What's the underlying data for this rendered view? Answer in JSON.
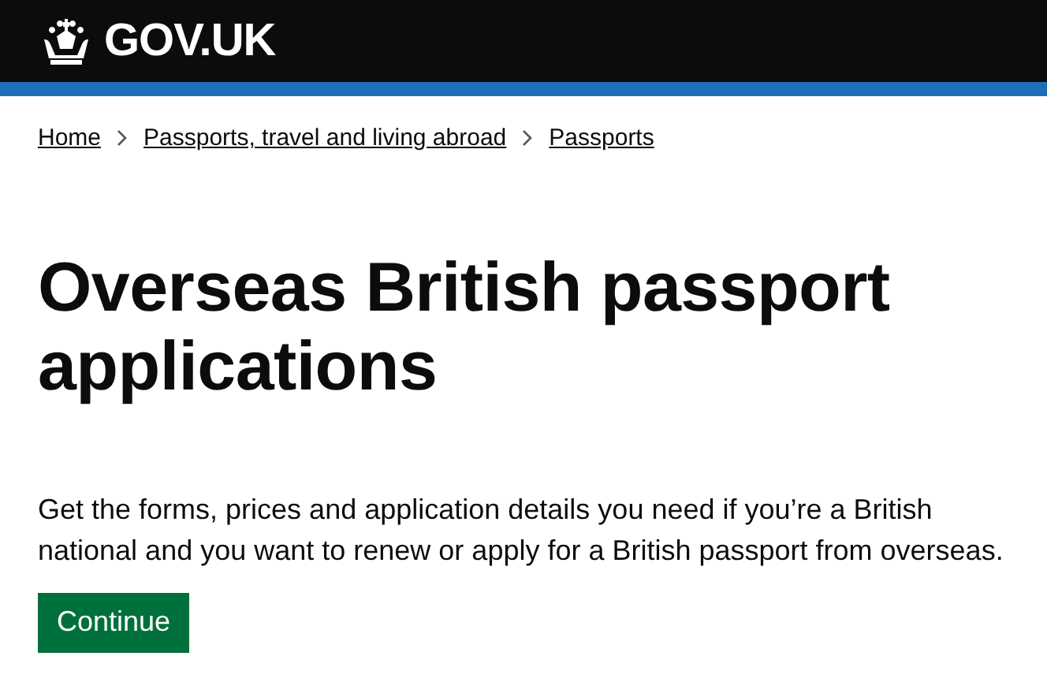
{
  "header": {
    "logo_text": "GOV.UK"
  },
  "breadcrumbs": [
    {
      "label": "Home"
    },
    {
      "label": "Passports, travel and living abroad"
    },
    {
      "label": "Passports"
    }
  ],
  "title": "Overseas British passport applications",
  "intro": "Get the forms, prices and application details you need if you’re a British national and you want to renew or apply for a British passport from overseas.",
  "button": {
    "label": "Continue"
  }
}
